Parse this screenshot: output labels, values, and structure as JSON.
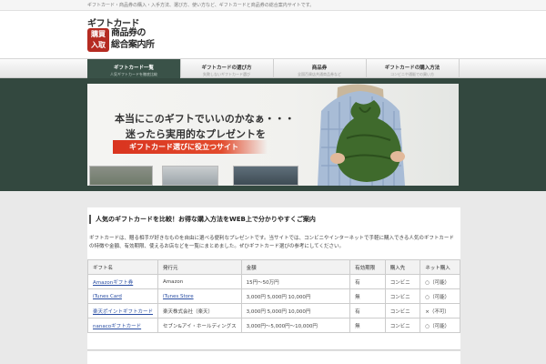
{
  "topbar": {
    "tagline": "ギフトカード・商品券の購入・入手方法、選び方、使い方など、ギフトカードと商品券の総合案内サイトです。"
  },
  "header": {
    "logo_line1": "ギフトカード",
    "logo_badge_top": "購買",
    "logo_badge_bottom": "入取",
    "logo_line2": "商品券の",
    "logo_line3": "総合案内所"
  },
  "nav": {
    "items": [
      {
        "title": "ギフトカード一覧",
        "sub": "人気ギフトカードを徹底比較"
      },
      {
        "title": "ギフトカードの選び方",
        "sub": "失敗しないギフトカード選び"
      },
      {
        "title": "商品券",
        "sub": "全国百貨店共通商品券など"
      },
      {
        "title": "ギフトカードの購入方法",
        "sub": "コンビニや通販での買い方"
      }
    ],
    "active_index": 0
  },
  "hero": {
    "line1": "本当にこのギフトでいいのかなぁ・・・",
    "line2": "迷ったら実用的なプレゼントを",
    "cta": "ギフトカード選びに役立つサイト"
  },
  "content": {
    "heading": "人気のギフトカードを比較！お得な購入方法をWEB上で分かりやすくご案内",
    "intro": "ギフトカードは、贈る相手が好きなものを自由に選べる便利なプレゼントです。当サイトでは、コンビニやインターネットで手軽に購入できる人気のギフトカードの特徴や金額、有効期限、使えるお店などを一覧にまとめました。ぜひギフトカード選びの参考にしてください。",
    "table": {
      "headers": [
        "ギフト名",
        "発行元",
        "金額",
        "有効期限",
        "購入先",
        "ネット購入"
      ],
      "rows": [
        [
          "Amazonギフト券",
          "Amazon",
          "15円〜50万円",
          "有",
          "コンビニ",
          "○（可能）"
        ],
        [
          "iTunes Card",
          "iTunes Store",
          "3,000円 5,000円 10,000円",
          "無",
          "コンビニ",
          "○（可能）"
        ],
        [
          "楽天ポイントギフトカード",
          "楽天株式会社（楽天）",
          "3,000円 5,000円 10,000円",
          "有",
          "コンビニ",
          "×（不可）"
        ],
        [
          "nanacoギフトカード",
          "セブン&アイ・ホールディングス",
          "3,000円～5,000円～10,000円",
          "無",
          "コンビニ",
          "○（可能）"
        ]
      ]
    }
  },
  "colors": {
    "band": "#33483f",
    "nav_active": "#3a5248",
    "cta": "#d9341f",
    "link": "#2a4ea3"
  }
}
